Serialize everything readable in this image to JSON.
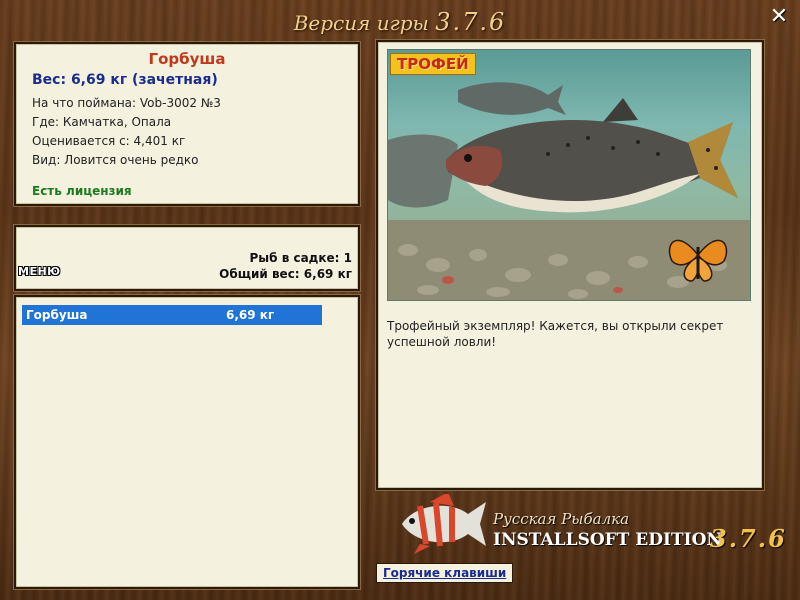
{
  "window": {
    "title_prefix": "Версия игры",
    "title_version": "3.7.6",
    "close_icon": "close-icon"
  },
  "fish_info": {
    "name": "Горбуша",
    "weight": "Вес: 6,69 кг (зачетная)",
    "caught_with": "На что поймана: Vob-3002 №3",
    "where": "Где: Камчатка, Опала",
    "rated_from": "Оценивается с: 4,401 кг",
    "kind": "Вид: Ловится очень редко",
    "license": "Есть лицензия"
  },
  "keepnet": {
    "menu_label": "МЕНЮ",
    "fish_count": "Рыб в садке: 1",
    "total_weight": "Общий вес: 6,69 кг"
  },
  "catch_list": [
    {
      "name": "Горбуша",
      "weight": "6,69 кг",
      "selected": true
    }
  ],
  "trophy": {
    "badge": "ТРОФЕЙ",
    "description": "Трофейный экземпляр! Кажется, вы открыли секрет успешной ловли!"
  },
  "logo": {
    "line1": "Русская Рыбалка",
    "line2": "INSTALLSOFT EDITION",
    "version": "3.7.6"
  },
  "footer": {
    "hotkeys_label": "Горячие клавиши"
  },
  "colors": {
    "wood": "#5b3417",
    "panel": "#f4f1df",
    "fish_name": "#c0391b",
    "weight": "#1a2c8c",
    "license": "#1d7a1f",
    "selection": "#1f74d6",
    "badge_bg": "#f3c21d",
    "badge_text": "#c52a12"
  }
}
